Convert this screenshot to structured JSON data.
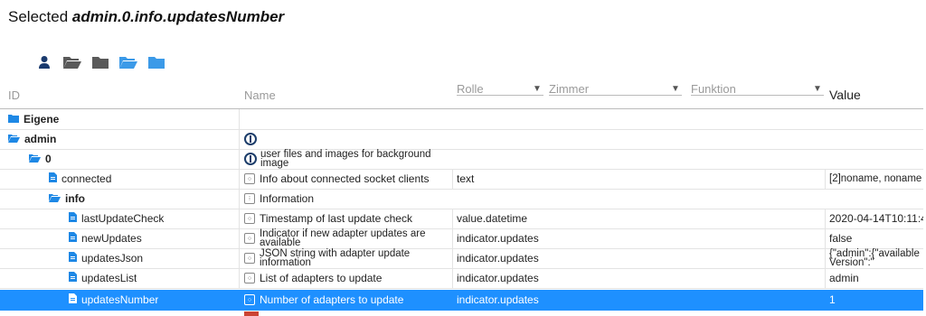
{
  "header": {
    "prefix": "Selected",
    "object_id": "admin.0.info.updatesNumber"
  },
  "toolbar": {
    "icons": [
      "person-icon",
      "folder-open-icon",
      "folder-closed-icon",
      "folder-open-blue-icon",
      "folder-closed-blue-icon"
    ]
  },
  "columns": {
    "id": "ID",
    "name": "Name",
    "role": "Rolle",
    "room": "Zimmer",
    "function": "Funktion",
    "value": "Value"
  },
  "rows": [
    {
      "id": "Eigene",
      "name": "",
      "role": "",
      "value": ""
    },
    {
      "id": "admin",
      "name": "",
      "role": "",
      "value": ""
    },
    {
      "id": "0",
      "name": "user files and images for background image",
      "role": "",
      "value": ""
    },
    {
      "id": "connected",
      "name": "Info about connected socket clients",
      "role": "text",
      "value": "[2]noname, noname"
    },
    {
      "id": "info",
      "name": "Information",
      "role": "",
      "value": ""
    },
    {
      "id": "lastUpdateCheck",
      "name": "Timestamp of last update check",
      "role": "value.datetime",
      "value": "2020-04-14T10:11:4"
    },
    {
      "id": "newUpdates",
      "name": "Indicator if new adapter updates are available",
      "role": "indicator.updates",
      "value": "false"
    },
    {
      "id": "updatesJson",
      "name": "JSON string with adapter update information",
      "role": "indicator.updates",
      "value": "{\"admin\":{\"availableVersion\":\""
    },
    {
      "id": "updatesList",
      "name": "List of adapters to update",
      "role": "indicator.updates",
      "value": "admin"
    },
    {
      "id": "updatesNumber",
      "name": "Number of adapters to update",
      "role": "indicator.updates",
      "value": "1"
    }
  ],
  "colors": {
    "accent": "#1e90ff",
    "folder_blue": "#3c9ae8",
    "folder_dark": "#5a5a5a"
  }
}
